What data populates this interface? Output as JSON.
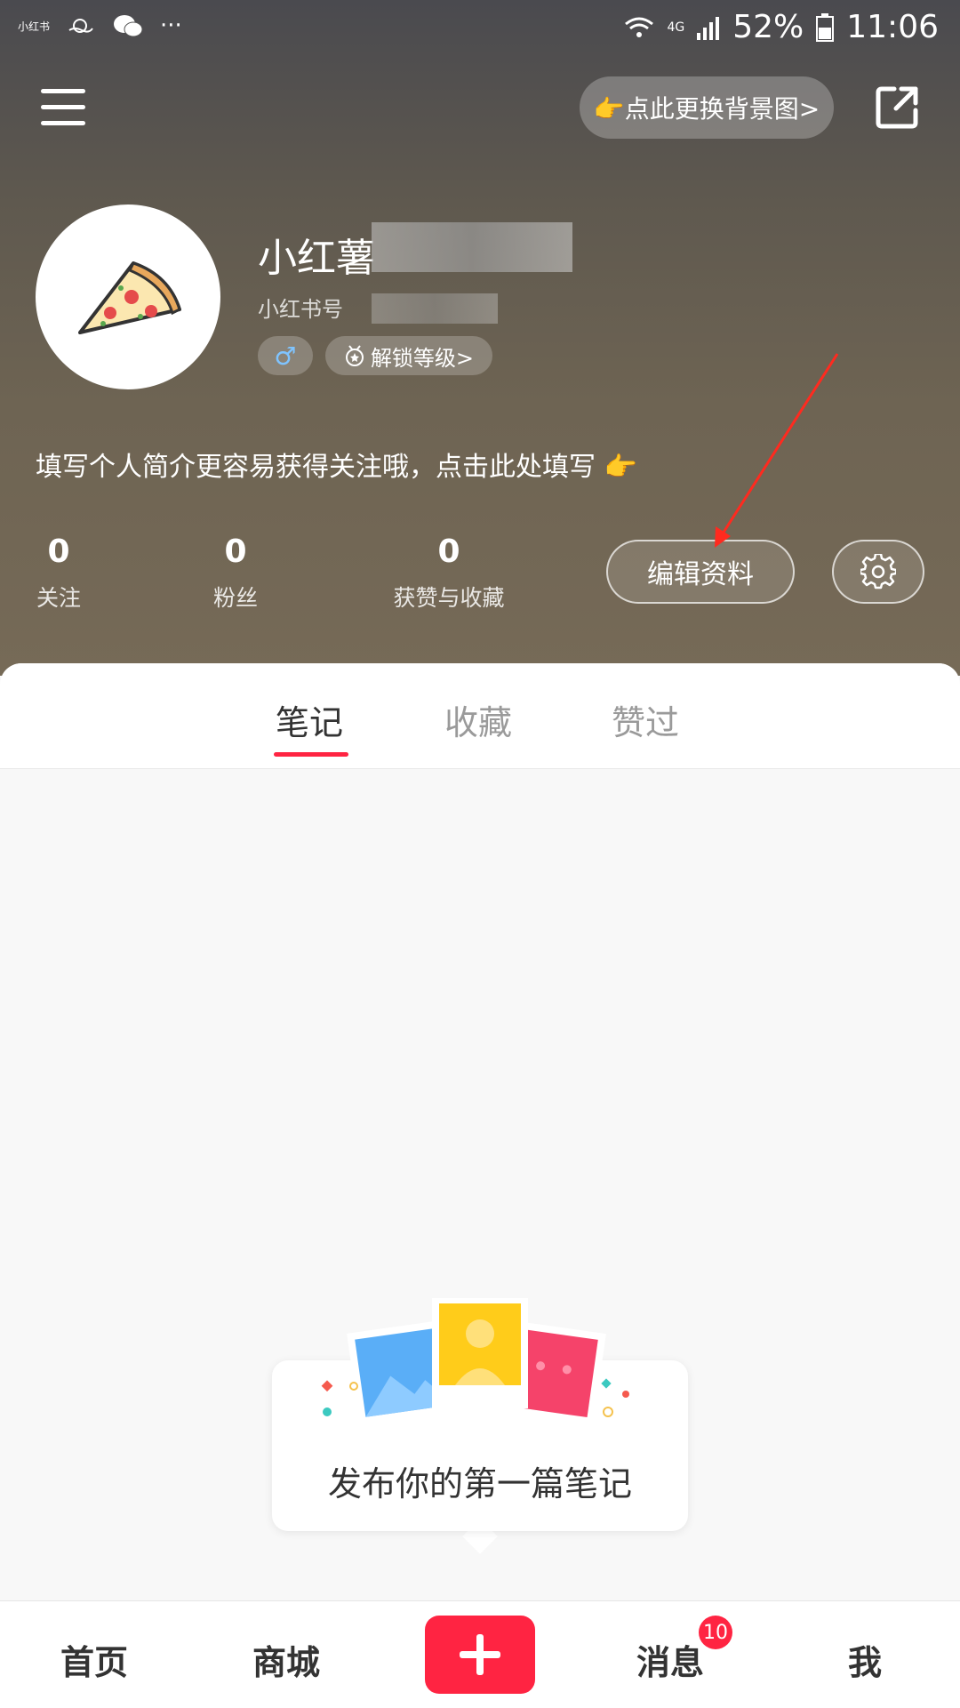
{
  "status_bar": {
    "app_label": "小红书",
    "more": "···",
    "network": "4G",
    "battery": "52%",
    "time": "11:06"
  },
  "header": {
    "change_bg_label": "👉点此更换背景图>",
    "username": "小红薯",
    "user_id_label": "小红书号",
    "gender_symbol": "♂",
    "level_label": "解锁等级>",
    "bio_prompt": "填写个人简介更容易获得关注哦，点击此处填写 👉",
    "edit_profile_label": "编辑资料"
  },
  "stats": [
    {
      "value": "0",
      "label": "关注"
    },
    {
      "value": "0",
      "label": "粉丝"
    },
    {
      "value": "0",
      "label": "获赞与收藏"
    }
  ],
  "tabs": [
    {
      "label": "笔记",
      "active": true
    },
    {
      "label": "收藏",
      "active": false
    },
    {
      "label": "赞过",
      "active": false
    }
  ],
  "empty_state": {
    "message": "发布你的第一篇笔记"
  },
  "bottom_nav": {
    "home": "首页",
    "mall": "商城",
    "messages": "消息",
    "messages_badge": "10",
    "me": "我"
  },
  "colors": {
    "accent": "#ff2442",
    "annotation_arrow": "#ff2a1f"
  }
}
